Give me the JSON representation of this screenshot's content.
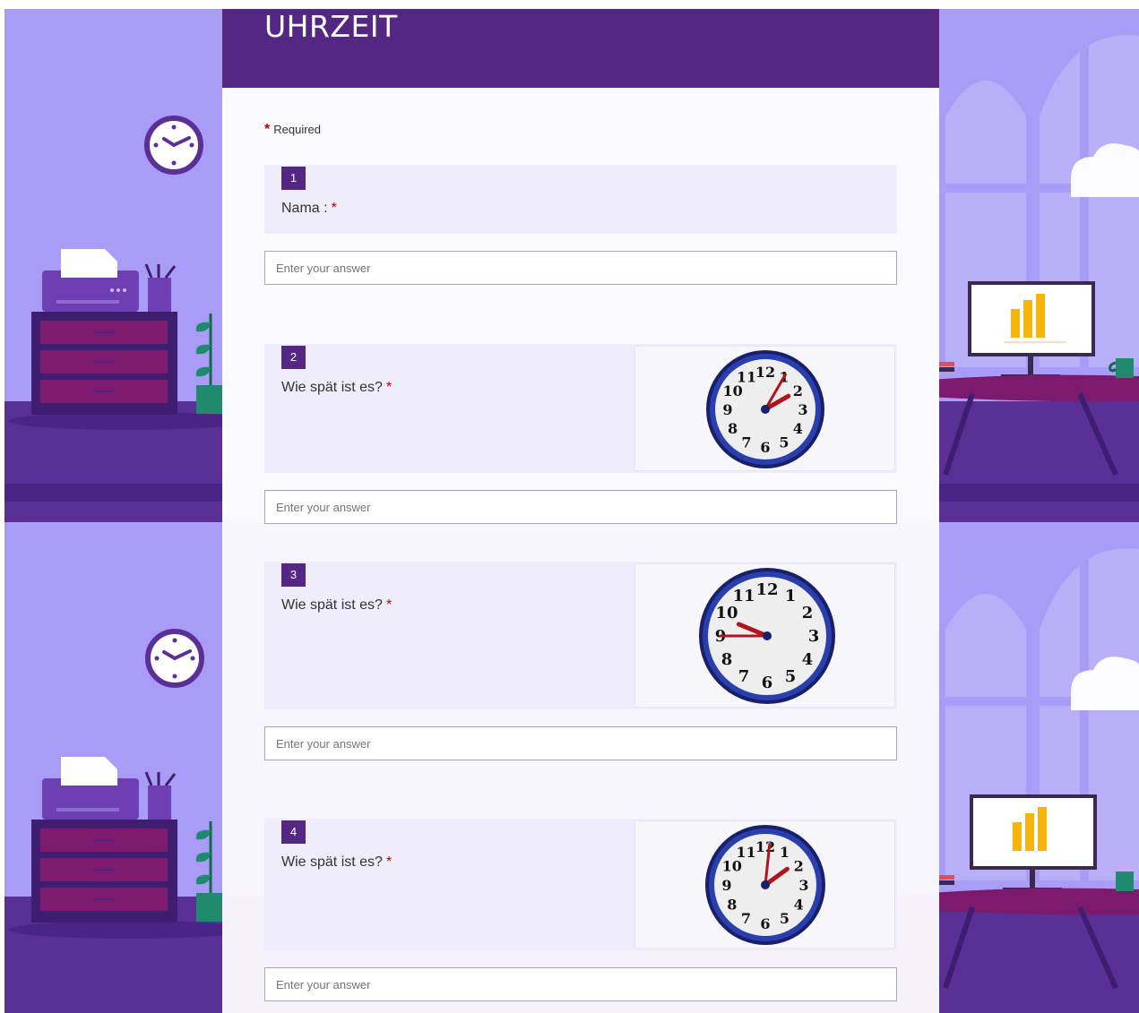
{
  "form": {
    "title": "UHRZEIT",
    "required_note": "Required",
    "required_mark": "*"
  },
  "questions": [
    {
      "number": "1",
      "label": "Nama :",
      "placeholder": "Enter your answer",
      "image": null
    },
    {
      "number": "2",
      "label": "Wie spät ist es?",
      "placeholder": "Enter your answer",
      "image": "clock-icon"
    },
    {
      "number": "3",
      "label": "Wie spät ist es?",
      "placeholder": "Enter your answer",
      "image": "clock-icon"
    },
    {
      "number": "4",
      "label": "Wie spät ist es?",
      "placeholder": "Enter your answer",
      "image": "clock-icon"
    }
  ],
  "clock_face_numbers": [
    "12",
    "1",
    "2",
    "3",
    "4",
    "5",
    "6",
    "7",
    "8",
    "9",
    "10",
    "11"
  ],
  "colors": {
    "brand": "#542782",
    "background": "#a99cf6",
    "required": "#c00000",
    "question_block": "#efecfb"
  }
}
